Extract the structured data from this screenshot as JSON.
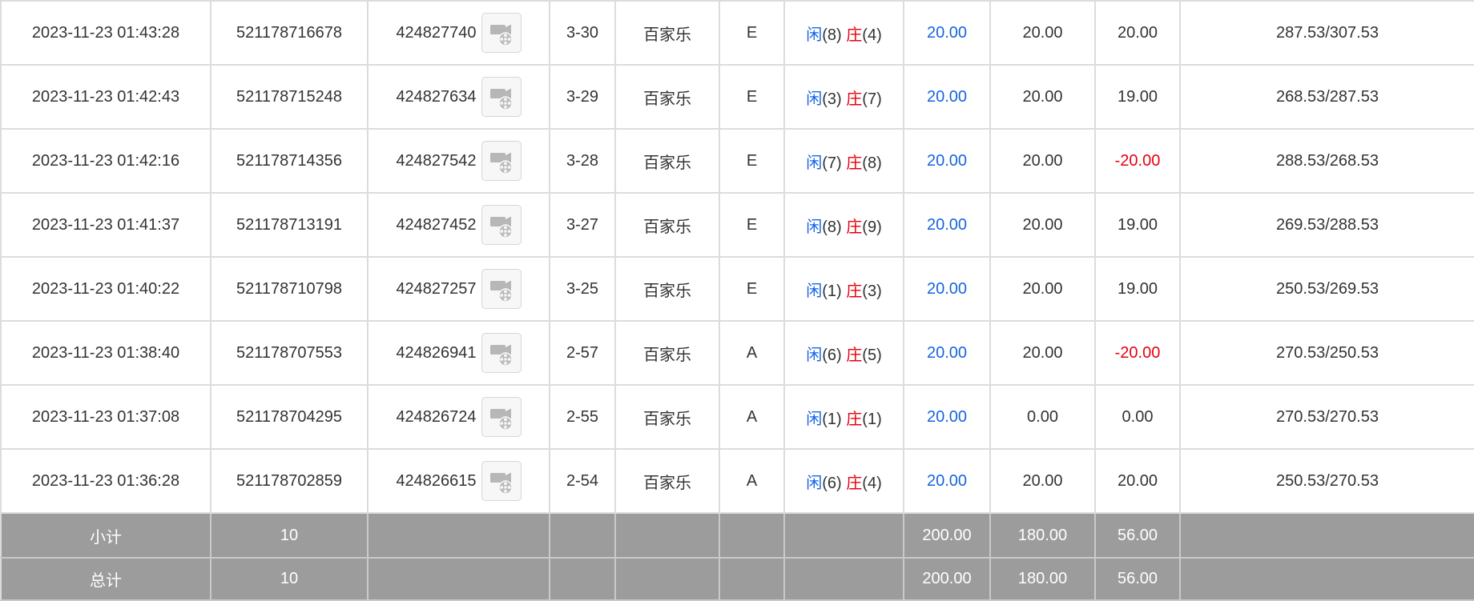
{
  "table": {
    "rows": [
      {
        "time": "2023-11-23 01:43:28",
        "order_no": "521178716678",
        "round_id": "424827740",
        "table_no": "3-30",
        "game": "百家乐",
        "bet_type": "E",
        "player_label": "闲",
        "player_points": "(8)",
        "banker_label": "庄",
        "banker_points": "(4)",
        "bet_amount": "20.00",
        "valid_bet": "20.00",
        "win_loss": "20.00",
        "win_loss_negative": false,
        "balance": "287.53/307.53"
      },
      {
        "time": "2023-11-23 01:42:43",
        "order_no": "521178715248",
        "round_id": "424827634",
        "table_no": "3-29",
        "game": "百家乐",
        "bet_type": "E",
        "player_label": "闲",
        "player_points": "(3)",
        "banker_label": "庄",
        "banker_points": "(7)",
        "bet_amount": "20.00",
        "valid_bet": "20.00",
        "win_loss": "19.00",
        "win_loss_negative": false,
        "balance": "268.53/287.53"
      },
      {
        "time": "2023-11-23 01:42:16",
        "order_no": "521178714356",
        "round_id": "424827542",
        "table_no": "3-28",
        "game": "百家乐",
        "bet_type": "E",
        "player_label": "闲",
        "player_points": "(7)",
        "banker_label": "庄",
        "banker_points": "(8)",
        "bet_amount": "20.00",
        "valid_bet": "20.00",
        "win_loss": "-20.00",
        "win_loss_negative": true,
        "balance": "288.53/268.53"
      },
      {
        "time": "2023-11-23 01:41:37",
        "order_no": "521178713191",
        "round_id": "424827452",
        "table_no": "3-27",
        "game": "百家乐",
        "bet_type": "E",
        "player_label": "闲",
        "player_points": "(8)",
        "banker_label": "庄",
        "banker_points": "(9)",
        "bet_amount": "20.00",
        "valid_bet": "20.00",
        "win_loss": "19.00",
        "win_loss_negative": false,
        "balance": "269.53/288.53"
      },
      {
        "time": "2023-11-23 01:40:22",
        "order_no": "521178710798",
        "round_id": "424827257",
        "table_no": "3-25",
        "game": "百家乐",
        "bet_type": "E",
        "player_label": "闲",
        "player_points": "(1)",
        "banker_label": "庄",
        "banker_points": "(3)",
        "bet_amount": "20.00",
        "valid_bet": "20.00",
        "win_loss": "19.00",
        "win_loss_negative": false,
        "balance": "250.53/269.53"
      },
      {
        "time": "2023-11-23 01:38:40",
        "order_no": "521178707553",
        "round_id": "424826941",
        "table_no": "2-57",
        "game": "百家乐",
        "bet_type": "A",
        "player_label": "闲",
        "player_points": "(6)",
        "banker_label": "庄",
        "banker_points": "(5)",
        "bet_amount": "20.00",
        "valid_bet": "20.00",
        "win_loss": "-20.00",
        "win_loss_negative": true,
        "balance": "270.53/250.53"
      },
      {
        "time": "2023-11-23 01:37:08",
        "order_no": "521178704295",
        "round_id": "424826724",
        "table_no": "2-55",
        "game": "百家乐",
        "bet_type": "A",
        "player_label": "闲",
        "player_points": "(1)",
        "banker_label": "庄",
        "banker_points": "(1)",
        "bet_amount": "20.00",
        "valid_bet": "0.00",
        "win_loss": "0.00",
        "win_loss_negative": false,
        "balance": "270.53/270.53"
      },
      {
        "time": "2023-11-23 01:36:28",
        "order_no": "521178702859",
        "round_id": "424826615",
        "table_no": "2-54",
        "game": "百家乐",
        "bet_type": "A",
        "player_label": "闲",
        "player_points": "(6)",
        "banker_label": "庄",
        "banker_points": "(4)",
        "bet_amount": "20.00",
        "valid_bet": "20.00",
        "win_loss": "20.00",
        "win_loss_negative": false,
        "balance": "250.53/270.53"
      }
    ],
    "subtotal": {
      "label": "小计",
      "count": "10",
      "bet_amount": "200.00",
      "valid_bet": "180.00",
      "win_loss": "56.00"
    },
    "total": {
      "label": "总计",
      "count": "10",
      "bet_amount": "200.00",
      "valid_bet": "180.00",
      "win_loss": "56.00"
    }
  },
  "icons": {
    "video_replay": "video-camera-film-reel-icon"
  },
  "colors": {
    "player": "#1565e0",
    "banker": "#e60012",
    "negative": "#e60012",
    "bet_amount": "#1565e0",
    "summary_bg": "#9c9c9c"
  }
}
